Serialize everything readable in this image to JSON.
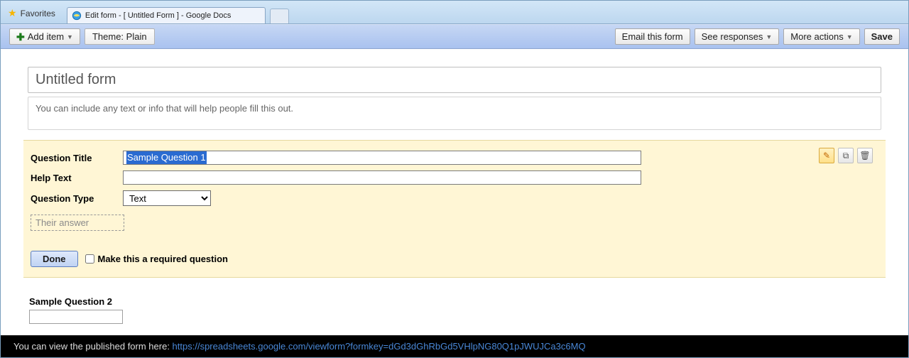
{
  "chrome": {
    "favorites_label": "Favorites",
    "tab_title": "Edit form - [ Untitled Form ] - Google Docs"
  },
  "toolbar": {
    "add_item_label": "Add item",
    "theme_label": "Theme:",
    "theme_value": "Plain",
    "email_label": "Email this form",
    "see_responses_label": "See responses",
    "more_actions_label": "More actions",
    "save_label": "Save"
  },
  "form": {
    "title": "Untitled form",
    "description": "You can include any text or info that will help people fill this out."
  },
  "question": {
    "title_label": "Question Title",
    "title_value": "Sample Question 1",
    "help_label": "Help Text",
    "help_value": "",
    "type_label": "Question Type",
    "type_value": "Text",
    "answer_placeholder": "Their answer",
    "done_label": "Done",
    "required_label": "Make this a required question"
  },
  "question2": {
    "title": "Sample Question 2"
  },
  "footer": {
    "lead": "You can view the published form here: ",
    "url": "https://spreadsheets.google.com/viewform?formkey=dGd3dGhRbGd5VHlpNG80Q1pJWUJCa3c6MQ"
  }
}
